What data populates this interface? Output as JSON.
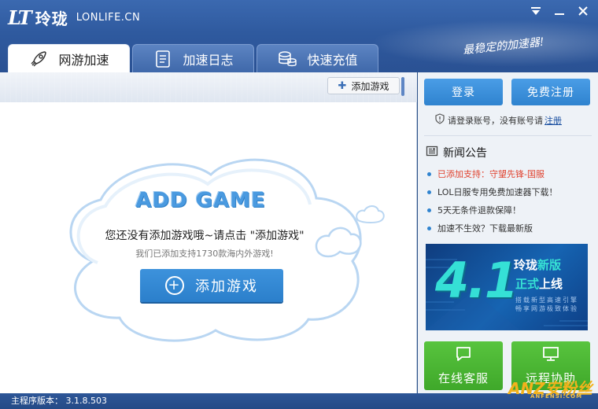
{
  "app": {
    "logo_mark": "LT",
    "logo_name": "玲珑",
    "logo_domain": "LONLIFE.CN",
    "slogan": "最稳定的加速器!"
  },
  "window_controls": [
    "menu-dropdown-icon",
    "minimize-icon",
    "close-icon"
  ],
  "tabs": [
    {
      "label": "网游加速",
      "icon": "rocket-icon",
      "active": true
    },
    {
      "label": "加速日志",
      "icon": "log-icon",
      "active": false
    },
    {
      "label": "快速充值",
      "icon": "coins-icon",
      "active": false
    }
  ],
  "main": {
    "add_small_label": "添加游戏",
    "title": "ADD GAME",
    "line1": "您还没有添加游戏哦~请点击 \"添加游戏\"",
    "line2": "我们已添加支持1730款海内外游戏!",
    "add_button_label": "添加游戏"
  },
  "side": {
    "login_label": "登录",
    "register_label": "免费注册",
    "login_hint": "请登录账号，没有账号请",
    "register_link": "注册",
    "news_title": "新闻公告",
    "news": [
      {
        "text": "已添加支持：守望先锋-国服",
        "hot": true
      },
      {
        "text": "LOL日服专用免费加速器下载！",
        "hot": false
      },
      {
        "text": "5天无条件退款保障！",
        "hot": false
      },
      {
        "text": "加速不生效？下载最新版",
        "hot": false
      }
    ],
    "banner": {
      "version": "4.1",
      "line1_a": "玲珑",
      "line1_b": "新版",
      "line2_a": "正式",
      "line2_b": "上线",
      "line3": "搭载新型高速引擎",
      "line4": "畅享网游极致体验"
    },
    "support_label": "在线客服",
    "remote_label": "远程协助"
  },
  "status": {
    "version_text": "主程序版本： 3.1.8.503"
  },
  "watermark": {
    "main": "ANZ安粉丝",
    "sub": "ANFENSI.COM"
  },
  "colors": {
    "header_blue": "#2f5a9f",
    "button_blue": "#2f83cf",
    "button_green": "#3fa82a",
    "hot_news": "#e0412e"
  }
}
